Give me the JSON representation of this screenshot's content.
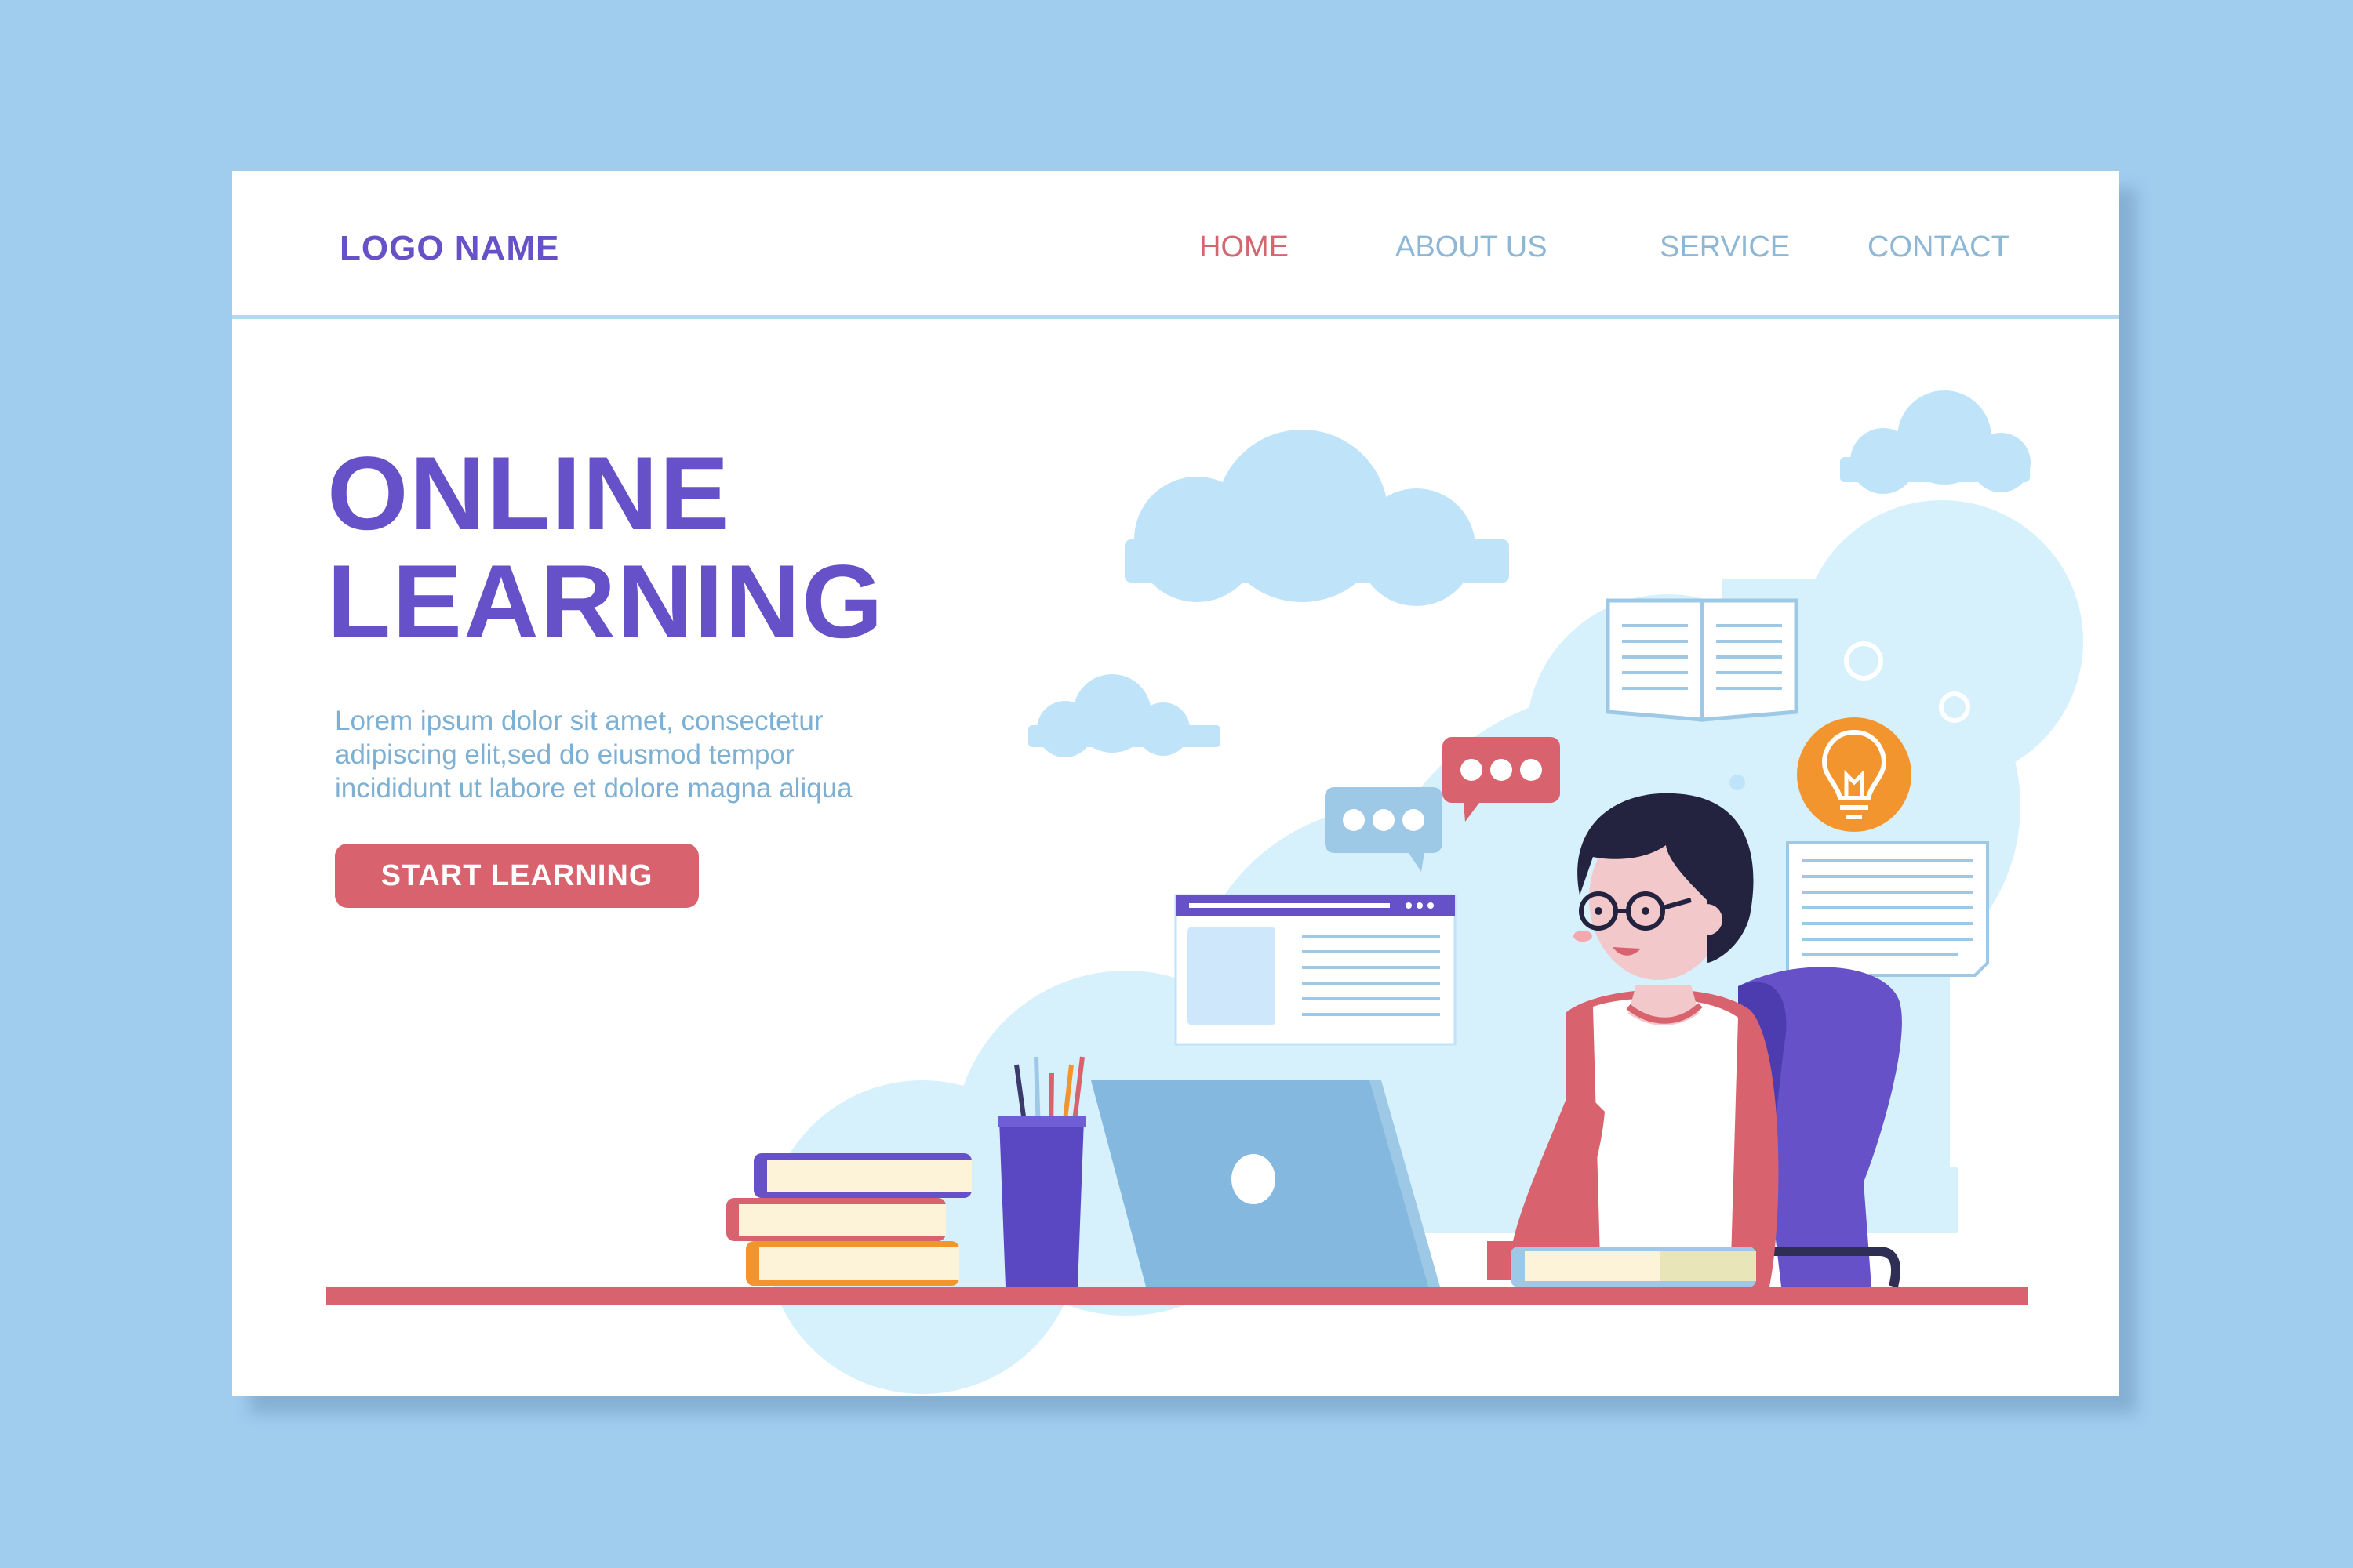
{
  "nav": {
    "logo": "LOGO NAME",
    "links": [
      {
        "label": "HOME",
        "active": true
      },
      {
        "label": "ABOUT US",
        "active": false
      },
      {
        "label": "SERVICE",
        "active": false
      },
      {
        "label": "CONTACT",
        "active": false
      }
    ]
  },
  "hero": {
    "title_lines": [
      "ONLINE",
      "LEARNING"
    ],
    "description_lines": [
      "Lorem ipsum dolor sit amet, consectetur",
      "adipiscing elit,sed do eiusmod tempor",
      "incididunt ut labore et dolore magna aliqua"
    ],
    "cta_label": "START LEARNING"
  },
  "colors": {
    "background": "#a0cdee",
    "brand_purple": "#6651c8",
    "accent_red": "#d8636e",
    "link_blue": "#8eb7d6",
    "cloud": "#bfe4fa",
    "bulb_orange": "#f3952f"
  },
  "icons": [
    "lightbulb-icon",
    "chat-bubble-icon",
    "open-book-icon",
    "document-icon",
    "laptop-icon"
  ]
}
